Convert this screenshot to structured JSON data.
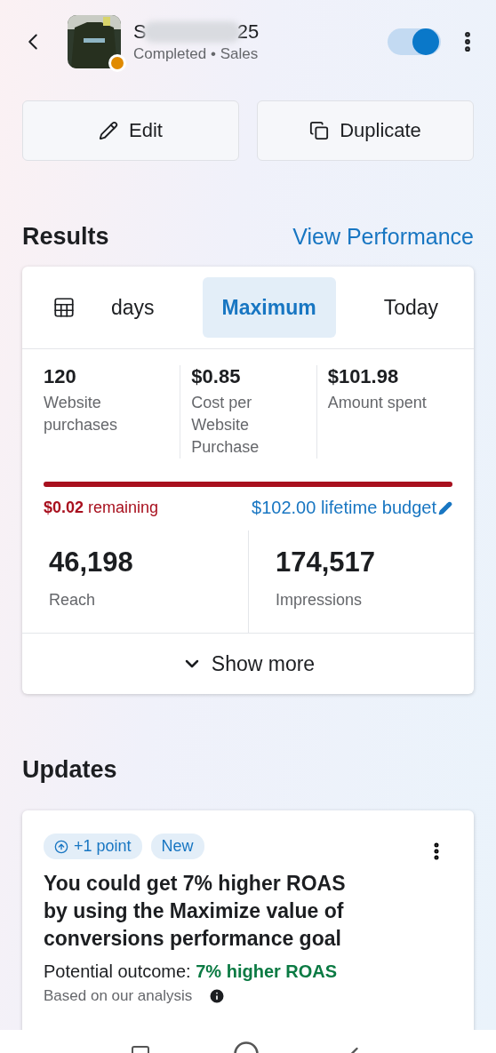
{
  "header": {
    "title_start": "S",
    "title_end": "25",
    "status": "Completed",
    "separator": "•",
    "objective": "Sales",
    "status_dot": {
      "color": "#e08a00"
    },
    "on": true
  },
  "actions": [
    {
      "kind": "edit",
      "label": "Edit"
    },
    {
      "kind": "duplicate",
      "label": "Duplicate"
    }
  ],
  "results": {
    "heading": "Results",
    "link": "View Performance",
    "tabs": [
      {
        "label": "days",
        "kind": "calendar",
        "selected": false
      },
      {
        "label": "Maximum",
        "kind": "plain",
        "selected": true
      },
      {
        "label": "Today",
        "kind": "plain",
        "selected": false
      }
    ],
    "stats": [
      {
        "value": "120",
        "label": "Website purchases"
      },
      {
        "value": "$0.85",
        "label": "Cost per Website Purchase"
      },
      {
        "value": "$101.98",
        "label": "Amount spent"
      }
    ],
    "budget": {
      "level": 1,
      "remaining": "**$0.02** remaining",
      "lifetime": "$102.00 lifetime budget"
    },
    "totals": [
      {
        "value": "46,198",
        "label": "Reach"
      },
      {
        "value": "174,517",
        "label": "Impressions"
      }
    ],
    "show_more": "Show more"
  },
  "updates": {
    "heading": "Updates",
    "badges": [
      {
        "kind": "points",
        "label": "+1 point"
      },
      {
        "kind": "plain",
        "label": "New"
      }
    ],
    "title": "You could get 7% higher ROAS by using the Maximize value of conversions performance goal",
    "outcome": "Potential outcome: **7% higher ROAS**",
    "note": "Based on our analysis"
  }
}
